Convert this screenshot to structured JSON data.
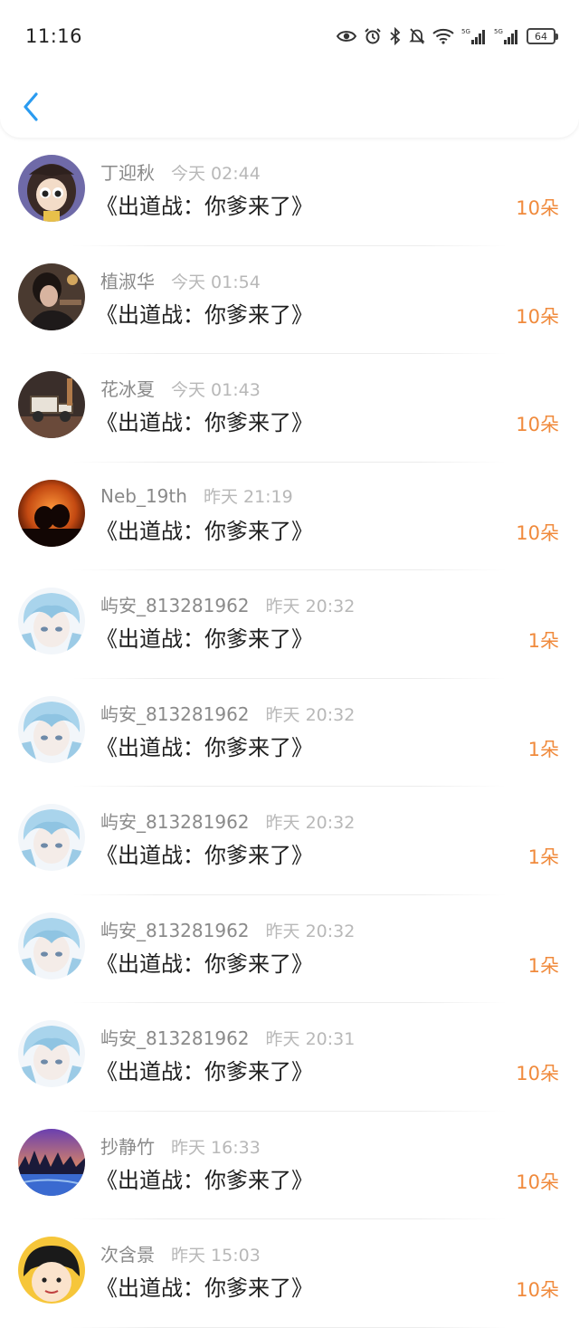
{
  "status_bar": {
    "time": "11:16",
    "signal1_label": "5G",
    "signal2_label": "5G",
    "battery": "64"
  },
  "nav": {
    "back_icon": "chevron-left-icon",
    "accent_color": "#2a9bf0"
  },
  "colors": {
    "amount": "#f08a3c",
    "name": "#8a8a8a",
    "time": "#b8b8b8",
    "title": "#1e1e1e"
  },
  "records": [
    {
      "name": "丁迎秋",
      "time": "今天 02:44",
      "title": "《出道战：你爹来了》",
      "amount": "10朵",
      "avatar": "anime-girl-avatar"
    },
    {
      "name": "植淑华",
      "time": "今天 01:54",
      "title": "《出道战：你爹来了》",
      "amount": "10朵",
      "avatar": "dark-photo-avatar"
    },
    {
      "name": "花冰夏",
      "time": "今天 01:43",
      "title": "《出道战：你爹来了》",
      "amount": "10朵",
      "avatar": "vintage-car-avatar"
    },
    {
      "name": "Neb_19th",
      "time": "昨天 21:19",
      "title": "《出道战：你爹来了》",
      "amount": "10朵",
      "avatar": "sunset-silhouette-avatar"
    },
    {
      "name": "屿安_813281962",
      "time": "昨天 20:32",
      "title": "《出道战：你爹来了》",
      "amount": "1朵",
      "avatar": "blue-hair-anime-avatar"
    },
    {
      "name": "屿安_813281962",
      "time": "昨天 20:32",
      "title": "《出道战：你爹来了》",
      "amount": "1朵",
      "avatar": "blue-hair-anime-avatar"
    },
    {
      "name": "屿安_813281962",
      "time": "昨天 20:32",
      "title": "《出道战：你爹来了》",
      "amount": "1朵",
      "avatar": "blue-hair-anime-avatar"
    },
    {
      "name": "屿安_813281962",
      "time": "昨天 20:32",
      "title": "《出道战：你爹来了》",
      "amount": "1朵",
      "avatar": "blue-hair-anime-avatar"
    },
    {
      "name": "屿安_813281962",
      "time": "昨天 20:31",
      "title": "《出道战：你爹来了》",
      "amount": "10朵",
      "avatar": "blue-hair-anime-avatar"
    },
    {
      "name": "抄静竹",
      "time": "昨天 16:33",
      "title": "《出道战：你爹来了》",
      "amount": "10朵",
      "avatar": "winter-landscape-avatar"
    },
    {
      "name": "次含景",
      "time": "昨天 15:03",
      "title": "《出道战：你爹来了》",
      "amount": "10朵",
      "avatar": "cartoon-girl-avatar"
    }
  ]
}
